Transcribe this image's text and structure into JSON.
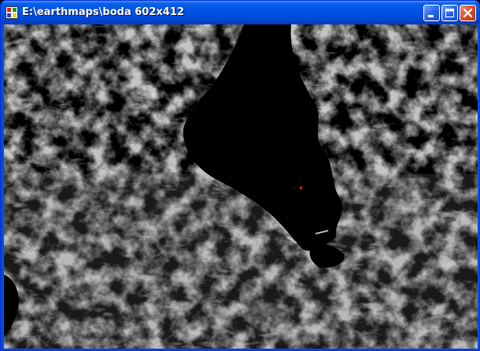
{
  "window": {
    "title": "E:\\earthmaps\\boda 602x412",
    "icon": "app-window-icon",
    "controls": [
      "minimize-icon",
      "maximize-icon",
      "close-icon"
    ]
  },
  "map": {
    "description_icon": "terrain-relief-map",
    "marker_color": "#ff2020"
  }
}
